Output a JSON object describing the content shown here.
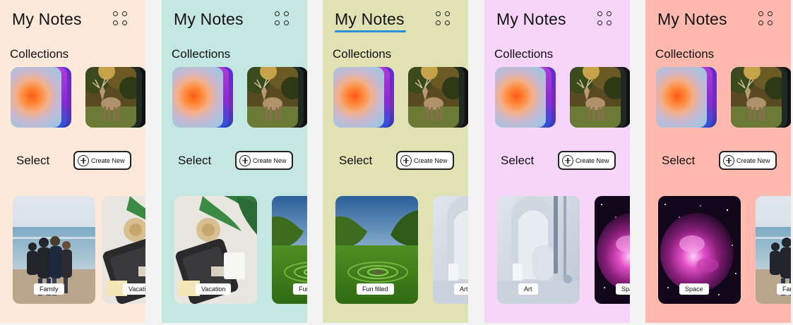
{
  "screens": [
    {
      "bg": "#fde9da",
      "title": "My Notes",
      "collections_label": "Collections",
      "select_label": "Select",
      "create_label": "Create New",
      "cards": [
        "Family",
        "Vacation"
      ]
    },
    {
      "bg": "#c5e7e2",
      "title": "My Notes",
      "collections_label": "Collections",
      "select_label": "Select",
      "create_label": "Create New",
      "cards": [
        "Vacation",
        "Fun filled"
      ]
    },
    {
      "bg": "#e1e2b4",
      "title": "My Notes",
      "collections_label": "Collections",
      "select_label": "Select",
      "create_label": "Create New",
      "cards": [
        "Fun filled",
        "Art"
      ]
    },
    {
      "bg": "#f7d5fb",
      "title": "My Notes",
      "collections_label": "Collections",
      "select_label": "Select",
      "create_label": "Create New",
      "cards": [
        "Art",
        "Space"
      ]
    },
    {
      "bg": "#ffb9ae",
      "title": "My Notes",
      "collections_label": "Collections",
      "select_label": "Select",
      "create_label": "Create New",
      "cards": [
        "Space",
        "Family"
      ]
    }
  ],
  "accent_underline": "#2b8fd6",
  "icons": {
    "menu": "grid-dots-icon",
    "create": "plus-circle-icon"
  }
}
